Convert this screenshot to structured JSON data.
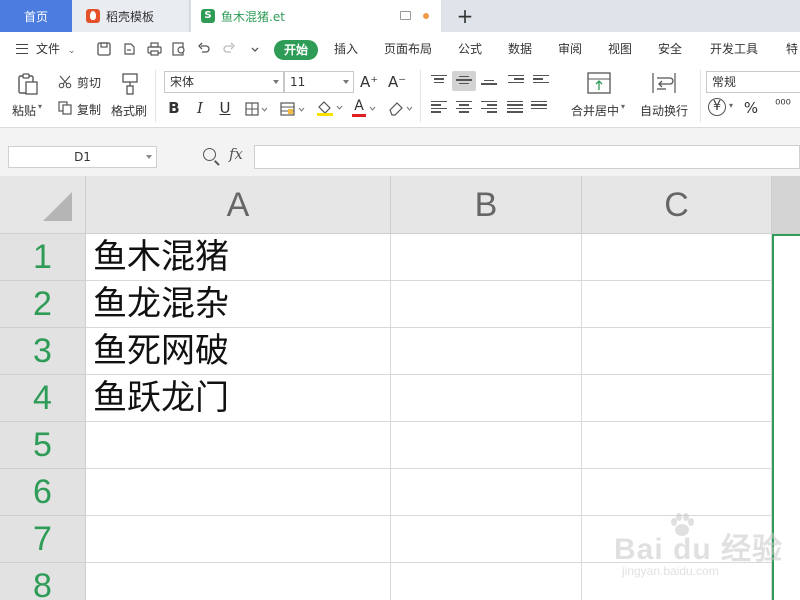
{
  "titlebar": {
    "tabs": [
      {
        "label": "首页"
      },
      {
        "label": "稻壳模板"
      },
      {
        "label": "鱼木混猪.et"
      }
    ],
    "file_logo_letter": "S",
    "new_tab_symbol": "+"
  },
  "menubar": {
    "file_label": "文件",
    "items": [
      "开始",
      "插入",
      "页面布局",
      "公式",
      "数据",
      "审阅",
      "视图",
      "安全",
      "开发工具",
      "特"
    ]
  },
  "ribbon": {
    "paste_label": "粘贴",
    "cut_label": "剪切",
    "copy_label": "复制",
    "format_painter_label": "格式刷",
    "font_name": "宋体",
    "font_size": "11",
    "font_grow": "A⁺",
    "font_shrink": "A⁻",
    "bold": "B",
    "italic": "I",
    "underline": "U",
    "font_color_letter": "A",
    "merge_label": "合并居中",
    "wrap_label": "自动换行",
    "number_format": "常规",
    "currency_symbol": "¥",
    "percent_symbol": "%",
    "thousands_symbol": "⁰⁰⁰"
  },
  "formulabar": {
    "cell_ref": "D1",
    "fx_label": "fx",
    "formula_value": ""
  },
  "grid": {
    "columns": [
      "A",
      "B",
      "C"
    ],
    "rows": [
      "1",
      "2",
      "3",
      "4",
      "5",
      "6",
      "7",
      "8"
    ],
    "cells_A": [
      "鱼木混猪",
      "鱼龙混杂",
      "鱼死网破",
      "鱼跃龙门",
      "",
      "",
      "",
      ""
    ]
  },
  "watermark": {
    "brand": "Bai du 经验",
    "url": "jingyan.baidu.com"
  },
  "colors": {
    "accent_green": "#2e9c57",
    "home_tab_blue": "#4b7de0"
  }
}
